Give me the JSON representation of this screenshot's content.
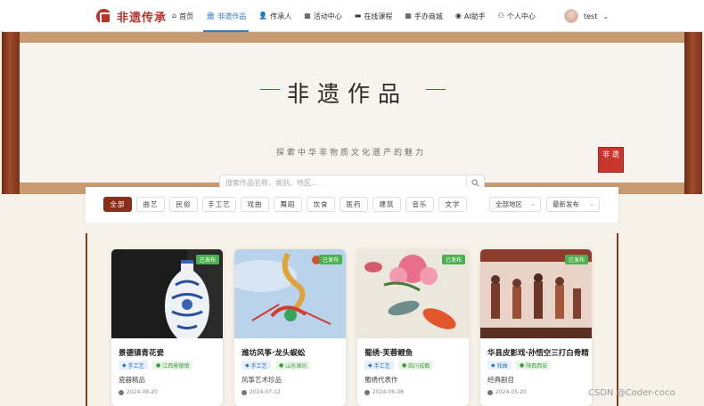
{
  "header": {
    "brand": "非遗传承",
    "nav": [
      {
        "icon": "⌂",
        "label": "首页"
      },
      {
        "icon": "🏛",
        "label": "非遗作品",
        "active": true
      },
      {
        "icon": "👤",
        "label": "传承人"
      },
      {
        "icon": "▦",
        "label": "活动中心"
      },
      {
        "icon": "▬",
        "label": "在线课程"
      },
      {
        "icon": "▦",
        "label": "手办商城"
      },
      {
        "icon": "◉",
        "label": "AI助手"
      },
      {
        "icon": "⚇",
        "label": "个人中心"
      }
    ],
    "user": {
      "name": "test"
    }
  },
  "banner": {
    "title": "非遗作品",
    "subtitle": "探索中华非物质文化遗产的魅力",
    "search_placeholder": "搜索作品名称、类别、地区...",
    "seal_text": "非 遗"
  },
  "filters": {
    "categories": [
      "全部",
      "曲艺",
      "民俗",
      "手工艺",
      "戏曲",
      "舞蹈",
      "饮食",
      "医药",
      "建筑",
      "音乐",
      "文学"
    ],
    "region": "全部地区",
    "sort": "最新发布"
  },
  "cards": [
    {
      "title": "景德镇青花瓷",
      "status": "已发布",
      "type": "手工艺",
      "location": "江西景德镇",
      "desc": "瓷器精品",
      "date": "2024-08-20"
    },
    {
      "title": "潍坊风筝·龙头蜈蚣",
      "status": "已发布",
      "type": "手工艺",
      "location": "山东潍坊",
      "desc": "风筝艺术珍品",
      "date": "2024-07-12"
    },
    {
      "title": "蜀绣·芙蓉鲤鱼",
      "status": "已发布",
      "type": "手工艺",
      "location": "四川成都",
      "desc": "蜀绣代表作",
      "date": "2024-06-08"
    },
    {
      "title": "华县皮影戏·孙悟空三打白骨精",
      "status": "已发布",
      "type": "戏曲",
      "location": "陕西西安",
      "desc": "经典剧目",
      "date": "2024-05-20"
    }
  ],
  "watermark": "CSDN @Coder-coco",
  "colors": {
    "accent": "#2f78c4",
    "brand_red": "#b8342c",
    "active_chip": "#8c2f1a",
    "status_green": "#4caf50"
  }
}
